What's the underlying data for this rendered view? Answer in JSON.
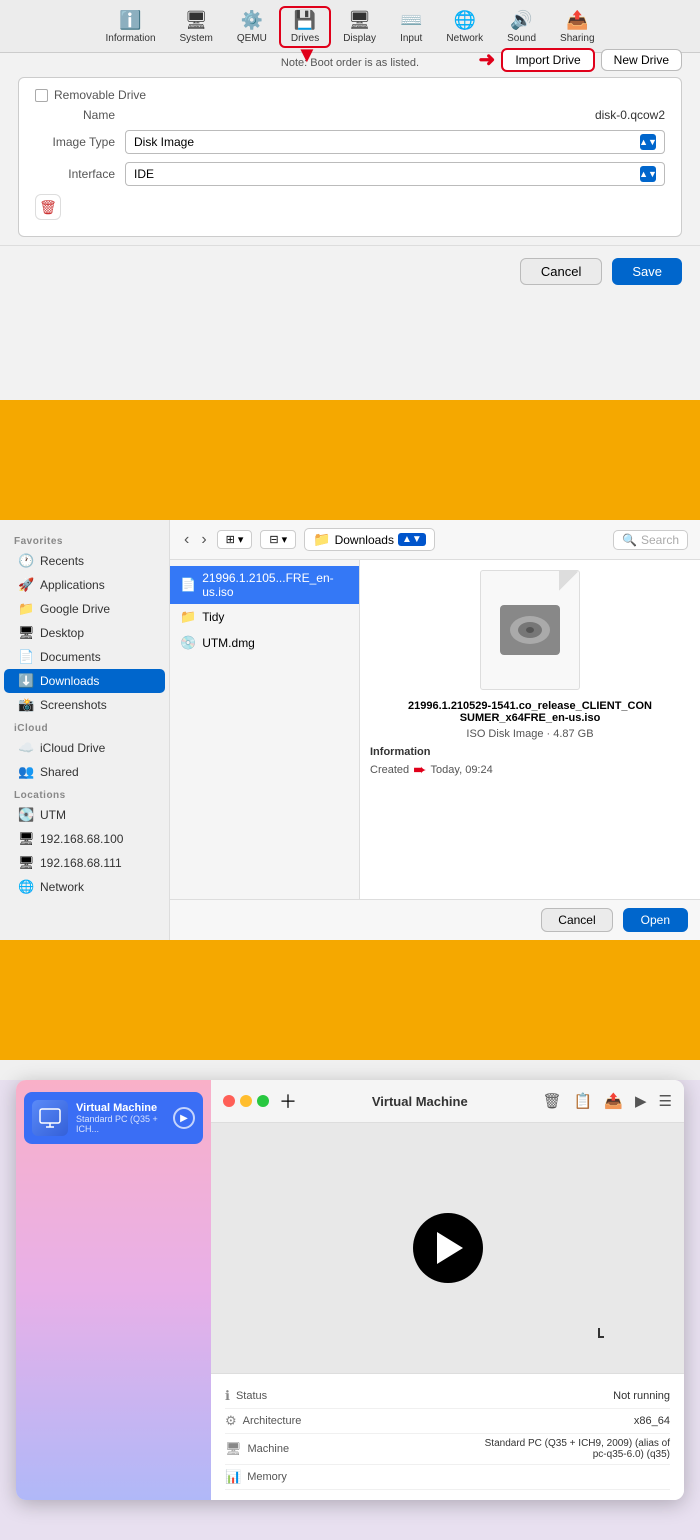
{
  "section1": {
    "toolbar": {
      "items": [
        {
          "id": "information",
          "label": "Information",
          "icon": "ℹ️"
        },
        {
          "id": "system",
          "label": "System",
          "icon": "🖥"
        },
        {
          "id": "qemu",
          "label": "QEMU",
          "icon": "⚙️"
        },
        {
          "id": "drives",
          "label": "Drives",
          "icon": "💾"
        },
        {
          "id": "display",
          "label": "Display",
          "icon": "🖥"
        },
        {
          "id": "input",
          "label": "Input",
          "icon": "⌨️"
        },
        {
          "id": "network",
          "label": "Network",
          "icon": "🌐"
        },
        {
          "id": "sound",
          "label": "Sound",
          "icon": "🔊"
        },
        {
          "id": "sharing",
          "label": "Sharing",
          "icon": "📤"
        }
      ]
    },
    "note": "Note: Boot order is as listed.",
    "import_button": "Import Drive",
    "new_button": "New Drive",
    "removable_label": "Removable Drive",
    "name_label": "Name",
    "name_value": "disk-0.qcow2",
    "image_type_label": "Image Type",
    "image_type_value": "Disk Image",
    "interface_label": "Interface",
    "interface_value": "IDE",
    "cancel_button": "Cancel",
    "save_button": "Save"
  },
  "section2": {
    "sidebar": {
      "favorites_label": "Favorites",
      "items_favorites": [
        {
          "id": "recents",
          "label": "Recents",
          "icon": "🕐"
        },
        {
          "id": "applications",
          "label": "Applications",
          "icon": "🚀"
        },
        {
          "id": "google-drive",
          "label": "Google Drive",
          "icon": "📁"
        },
        {
          "id": "desktop",
          "label": "Desktop",
          "icon": "🖥"
        },
        {
          "id": "documents",
          "label": "Documents",
          "icon": "📄"
        },
        {
          "id": "downloads",
          "label": "Downloads",
          "icon": "⬇️"
        },
        {
          "id": "screenshots",
          "label": "Screenshots",
          "icon": "📸"
        }
      ],
      "icloud_label": "iCloud",
      "items_icloud": [
        {
          "id": "icloud-drive",
          "label": "iCloud Drive",
          "icon": "☁️"
        },
        {
          "id": "shared",
          "label": "Shared",
          "icon": "👥"
        }
      ],
      "locations_label": "Locations",
      "items_locations": [
        {
          "id": "utm",
          "label": "UTM",
          "icon": "💽"
        },
        {
          "id": "ip1",
          "label": "192.168.68.100",
          "icon": "🖥"
        },
        {
          "id": "ip2",
          "label": "192.168.68.111",
          "icon": "🖥"
        },
        {
          "id": "network",
          "label": "Network",
          "icon": "🌐"
        }
      ]
    },
    "location_label": "Downloads",
    "search_placeholder": "Search",
    "files": [
      {
        "id": "iso-file",
        "name": "21996.1.2105...FRE_en-us.iso",
        "icon": "📄",
        "selected": true
      },
      {
        "id": "tidy-folder",
        "name": "Tidy",
        "icon": "📁",
        "selected": false
      },
      {
        "id": "utm-dmg",
        "name": "UTM.dmg",
        "icon": "💿",
        "selected": false
      }
    ],
    "preview": {
      "filename": "21996.1.210529-1541.co_release_CLIENT_CONSUMER_x64FRE_en-us.iso",
      "type": "ISO Disk Image · 4.87 GB",
      "info_label": "Information",
      "created_label": "Created",
      "created_value": "Today, 09:24"
    },
    "cancel_button": "Cancel",
    "open_button": "Open"
  },
  "section3": {
    "window_title": "Virtual Machine",
    "vm_item": {
      "name": "Virtual Machine",
      "desc": "Standard PC (Q35 + ICH..."
    },
    "info_rows": [
      {
        "icon": "ℹ",
        "label": "Status",
        "value": "Not running"
      },
      {
        "icon": "⚙",
        "label": "Architecture",
        "value": "x86_64"
      },
      {
        "icon": "🖥",
        "label": "Machine",
        "value": "Standard PC (Q35 + ICH9, 2009) (alias of pc-q35-6.0) (q35)"
      },
      {
        "icon": "📊",
        "label": "Memory",
        "value": ""
      }
    ]
  }
}
